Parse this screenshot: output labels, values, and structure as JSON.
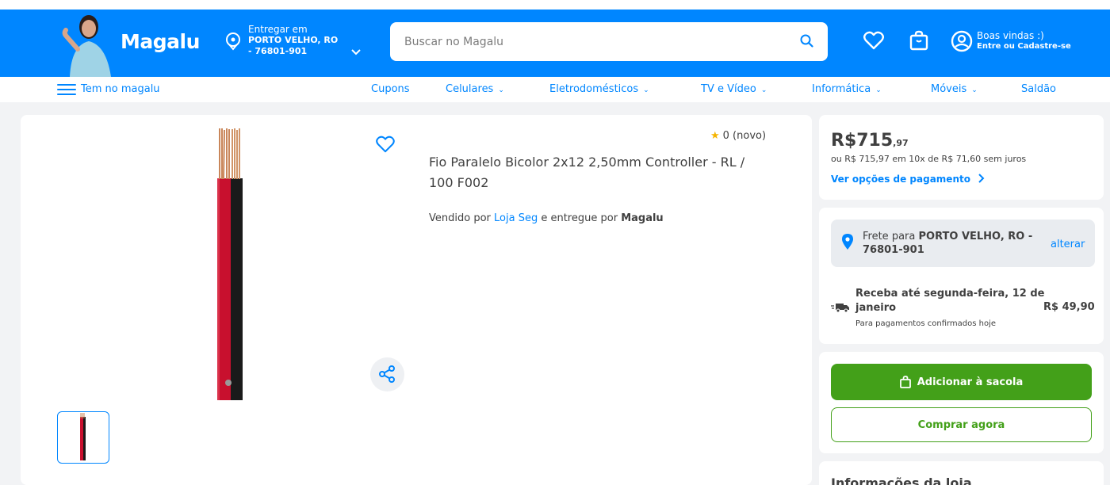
{
  "header": {
    "logo": "Magalu",
    "delivery": {
      "label": "Entregar em",
      "city": "PORTO VELHO, RO",
      "cep": "- 76801-901"
    },
    "search": {
      "placeholder": "Buscar no Magalu"
    },
    "user": {
      "greeting": "Boas vindas :)",
      "cta": "Entre ou Cadastre-se"
    }
  },
  "nav": {
    "menu_label": "Tem no magalu",
    "items": [
      {
        "label": "Cupons",
        "dropdown": false
      },
      {
        "label": "Celulares",
        "dropdown": true
      },
      {
        "label": "Eletrodomésticos",
        "dropdown": true
      },
      {
        "label": "TV e Vídeo",
        "dropdown": true
      },
      {
        "label": "Informática",
        "dropdown": true
      },
      {
        "label": "Móveis",
        "dropdown": true
      },
      {
        "label": "Saldão",
        "dropdown": false
      }
    ]
  },
  "product": {
    "rating_text": "0 (novo)",
    "title": "Fio Paralelo Bicolor 2x12 2,50mm Controller - RL / 100 F002",
    "seller_prefix": "Vendido por",
    "seller_name": "Loja Seg",
    "seller_mid": "e entregue por",
    "delivered_by": "Magalu"
  },
  "pricing": {
    "price_whole": "R$715",
    "price_cents": ",97",
    "installments": "ou R$ 715,97 em 10x de R$ 71,60 sem juros",
    "payment_link": "Ver opções de pagamento"
  },
  "shipping": {
    "freight_prefix": "Frete para",
    "freight_dest": "PORTO VELHO, RO - 76801-901",
    "change_link": "alterar",
    "receive_text": "Receba até segunda-feira, 12 de janeiro",
    "price": "R$ 49,90",
    "note": "Para pagamentos confirmados hoje"
  },
  "actions": {
    "add_to_bag": "Adicionar à sacola",
    "buy_now": "Comprar agora"
  },
  "store_info": {
    "title": "Informações da loja"
  },
  "colors": {
    "brand_blue": "#0086ff",
    "buy_green": "#43a019",
    "star": "#f5b400"
  }
}
